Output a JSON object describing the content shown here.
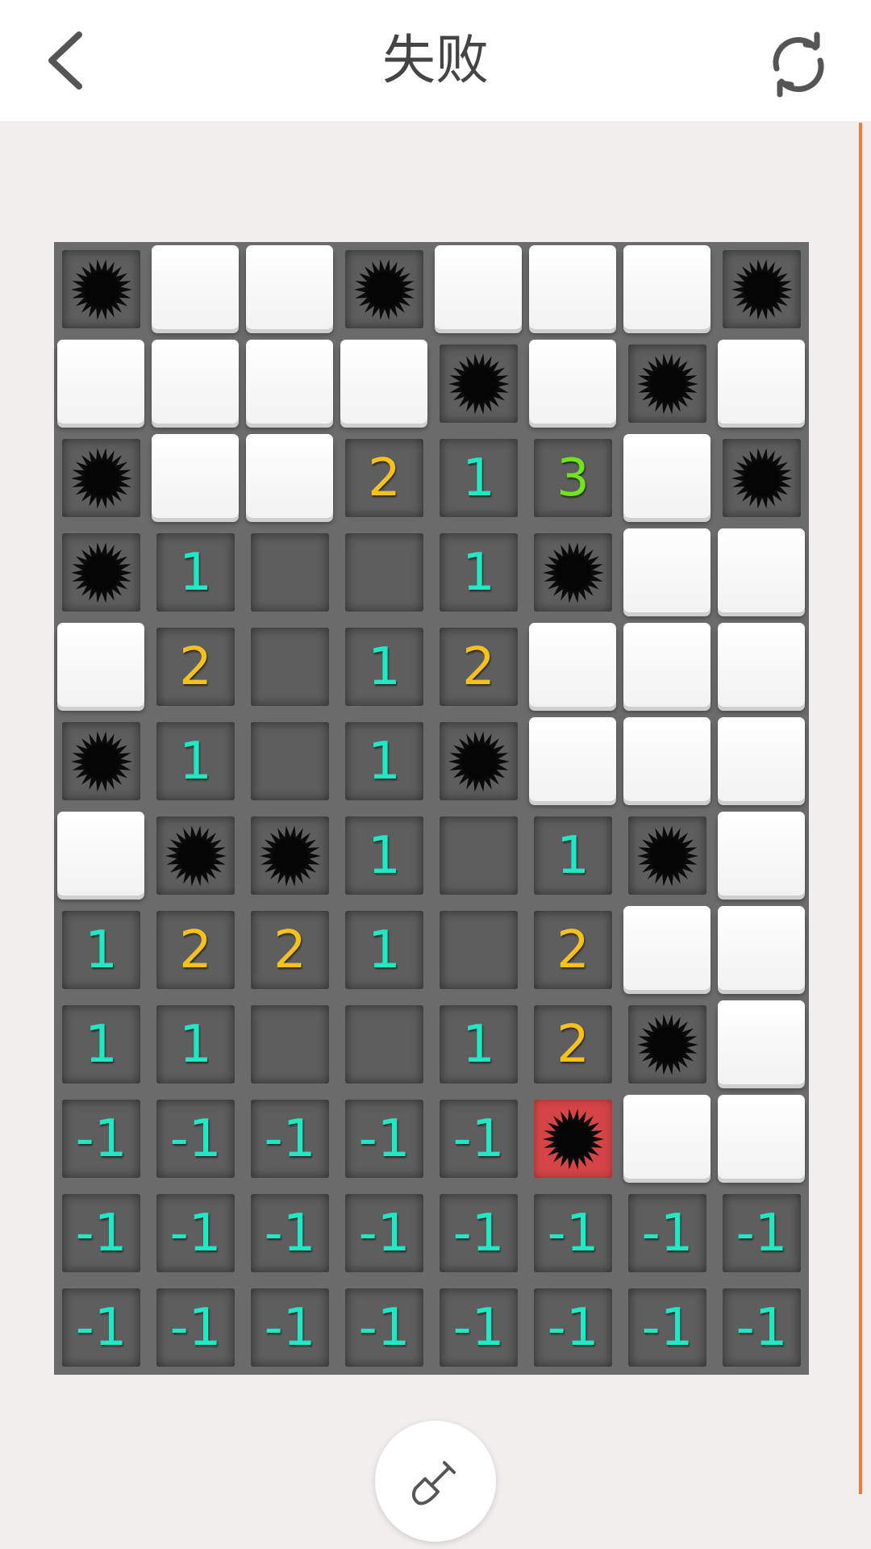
{
  "header": {
    "title": "失败",
    "back_icon": "chevron-left-icon",
    "restart_icon": "refresh-icon"
  },
  "colors": {
    "accent": "#ee7a35",
    "num_1": "#1fe8c4",
    "num_2": "#f6c21a",
    "num_3": "#6fe617",
    "exploded": "#d64545"
  },
  "board": {
    "rows": 12,
    "cols": 8,
    "cells": [
      [
        "M",
        "H",
        "H",
        "M",
        "H",
        "H",
        "H",
        "M"
      ],
      [
        "H",
        "H",
        "H",
        "H",
        "M",
        "H",
        "M",
        "H"
      ],
      [
        "M",
        "H",
        "H",
        "2",
        "1",
        "3",
        "H",
        "M"
      ],
      [
        "M",
        "1",
        "0",
        "0",
        "1",
        "M",
        "H",
        "H"
      ],
      [
        "H",
        "2",
        "0",
        "1",
        "2",
        "H",
        "H",
        "H"
      ],
      [
        "M",
        "1",
        "0",
        "1",
        "M",
        "H",
        "H",
        "H"
      ],
      [
        "H",
        "M",
        "M",
        "1",
        "0",
        "1",
        "M",
        "H"
      ],
      [
        "1",
        "2",
        "2",
        "1",
        "0",
        "2",
        "H",
        "H"
      ],
      [
        "1",
        "1",
        "0",
        "0",
        "1",
        "2",
        "M",
        "H"
      ],
      [
        "-1",
        "-1",
        "-1",
        "-1",
        "-1",
        "X",
        "H",
        "H"
      ],
      [
        "-1",
        "-1",
        "-1",
        "-1",
        "-1",
        "-1",
        "-1",
        "-1"
      ],
      [
        "-1",
        "-1",
        "-1",
        "-1",
        "-1",
        "-1",
        "-1",
        "-1"
      ]
    ]
  },
  "dig_button": {
    "icon": "shovel-icon"
  }
}
